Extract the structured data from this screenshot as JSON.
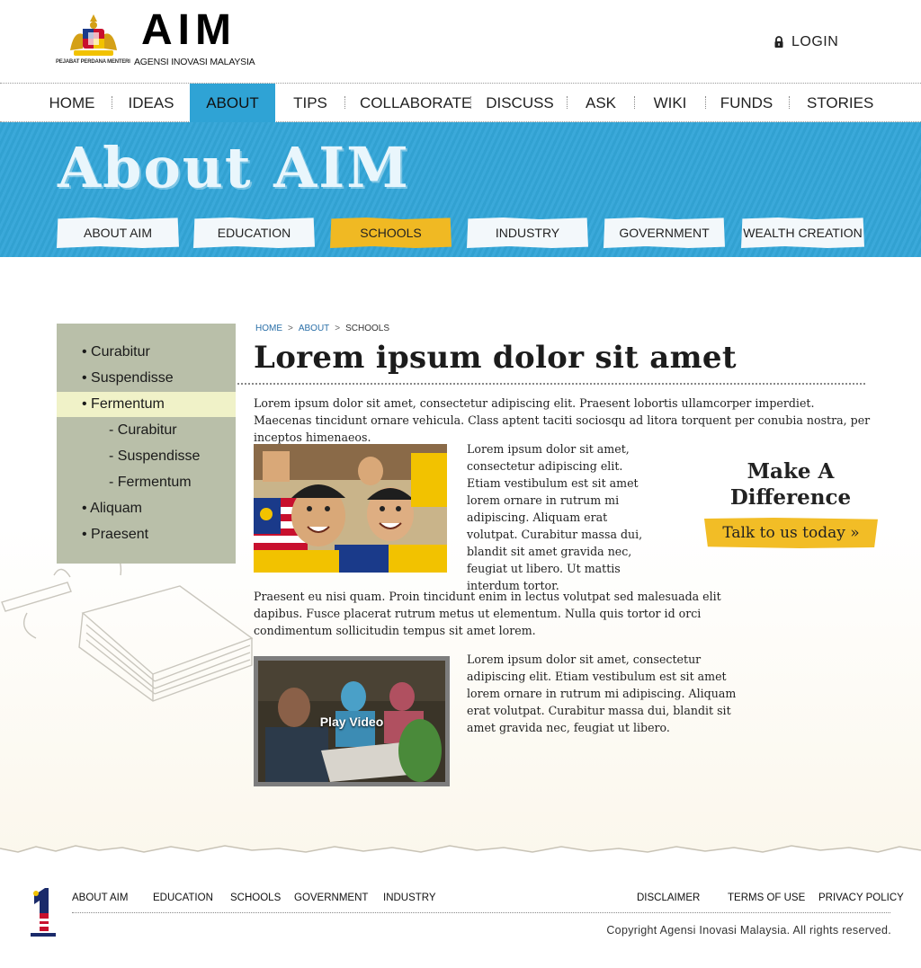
{
  "header": {
    "crest_caption": "PEJABAT PERDANA MENTERI",
    "logo_word": "AIM",
    "logo_sub": "AGENSI INOVASI MALAYSIA",
    "login": "LOGIN"
  },
  "nav": {
    "items": [
      "HOME",
      "IDEAS",
      "ABOUT",
      "TIPS",
      "COLLABORATE",
      "DISCUSS",
      "ASK",
      "WIKI",
      "FUNDS",
      "STORIES"
    ],
    "active": "ABOUT"
  },
  "banner": {
    "title": "About AIM",
    "subnav": [
      "ABOUT AIM",
      "EDUCATION",
      "SCHOOLS",
      "INDUSTRY",
      "GOVERNMENT",
      "WEALTH CREATION"
    ],
    "active": "SCHOOLS"
  },
  "sidemenu": {
    "items": [
      "• Curabitur",
      "• Suspendisse",
      "• Fermentum",
      "- Curabitur",
      "- Suspendisse",
      "- Fermentum",
      "• Aliquam",
      "• Praesent"
    ],
    "active": "• Fermentum"
  },
  "breadcrumb": {
    "home": "HOME",
    "about": "ABOUT",
    "sep": ">",
    "current": "SCHOOLS"
  },
  "content": {
    "title": "Lorem ipsum dolor sit amet",
    "intro": "Lorem ipsum dolor sit amet, consectetur adipiscing elit. Praesent lobortis ullamcorper imperdiet. Maecenas tincidunt ornare vehicula. Class aptent taciti sociosqu ad litora torquent per conubia nostra, per inceptos himenaeos.",
    "para1": "Lorem ipsum dolor sit amet, consectetur adipiscing elit. Etiam vestibulum est sit amet lorem ornare in rutrum mi adipiscing. Aliquam erat volutpat. Curabitur massa dui, blandit sit amet gravida nec, feugiat ut libero. Ut mattis interdum tortor.",
    "para2": "Praesent eu nisi quam. Proin tincidunt enim in lectus volutpat sed malesuada elit dapibus. Fusce placerat rutrum metus ut elementum. Nulla quis tortor id orci condimentum sollicitudin tempus sit amet lorem.",
    "para3": "Lorem ipsum dolor sit amet, consectetur adipiscing elit. Etiam vestibulum est sit amet lorem ornare in rutrum mi adipiscing. Aliquam erat volutpat. Curabitur massa dui, blandit sit amet gravida nec, feugiat ut libero.",
    "video_label": "Play Video"
  },
  "cta": {
    "title": "Make A Difference",
    "button": "Talk to us today »"
  },
  "footer": {
    "left_links": [
      "ABOUT AIM",
      "EDUCATION",
      "SCHOOLS",
      "GOVERNMENT",
      "INDUSTRY"
    ],
    "right_links": [
      "DISCLAIMER",
      "TERMS OF USE",
      "PRIVACY POLICY"
    ],
    "copyright": "Copyright Agensi Inovasi Malaysia. All rights reserved."
  },
  "colors": {
    "banner_blue": "#33a6d8",
    "nav_active": "#2fa3d5",
    "accent_yellow": "#f2bd26",
    "sidemenu_bg": "#b9bfa9",
    "sidemenu_active": "#f0f2c8"
  },
  "icons": {
    "login": "lock-icon",
    "crest": "malaysia-crest-icon",
    "footer_logo": "1malaysia-logo-icon"
  }
}
